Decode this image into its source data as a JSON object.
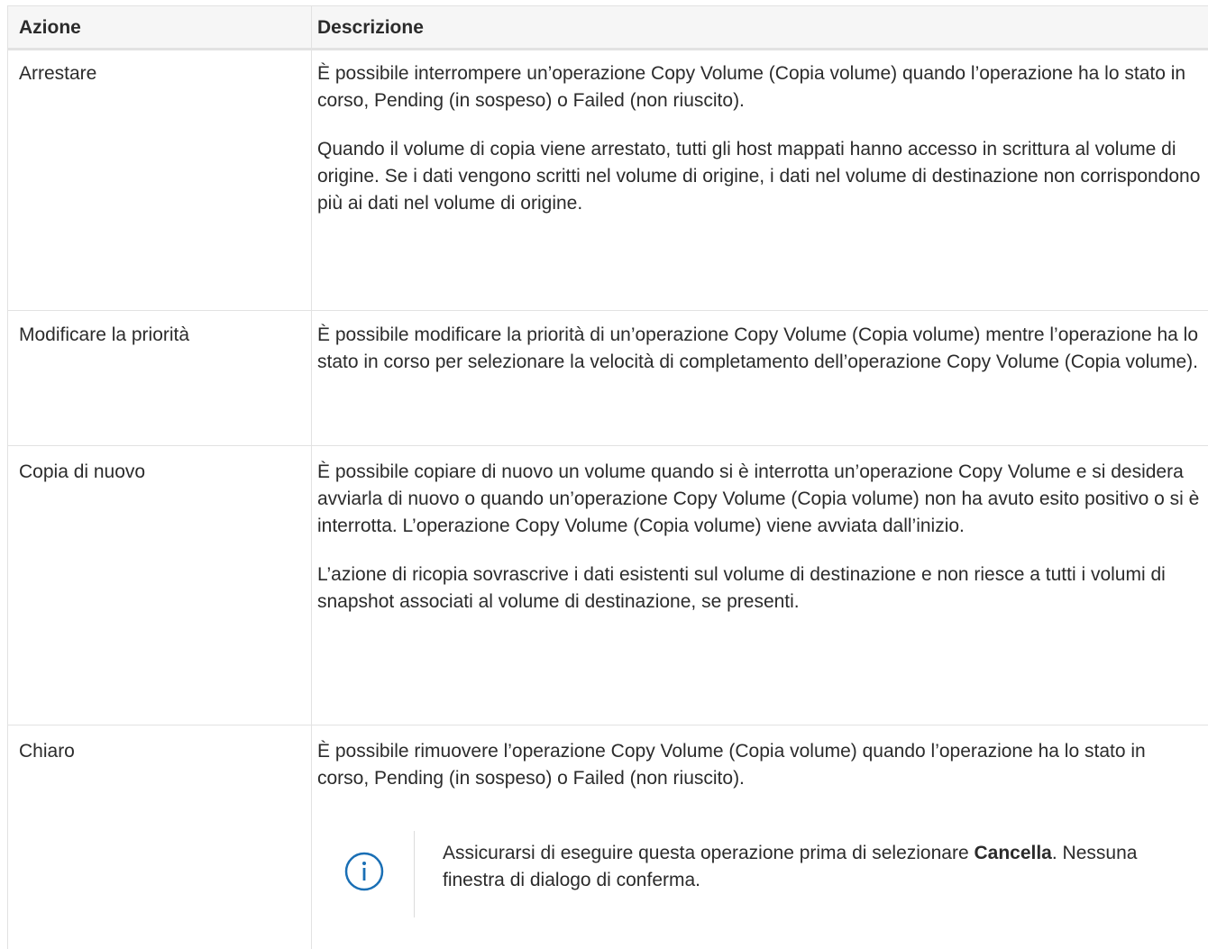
{
  "table": {
    "headers": {
      "action": "Azione",
      "description": "Descrizione"
    },
    "rows": [
      {
        "action": "Arrestare",
        "paragraphs": [
          "È possibile interrompere un’operazione Copy Volume (Copia volume) quando l’operazione ha lo stato in corso, Pending (in sospeso) o Failed (non riuscito).",
          "Quando il volume di copia viene arrestato, tutti gli host mappati hanno accesso in scrittura al volume di origine. Se i dati vengono scritti nel volume di origine, i dati nel volume di destinazione non corrispondono più ai dati nel volume di origine."
        ]
      },
      {
        "action": "Modificare la priorità",
        "paragraphs": [
          "È possibile modificare la priorità di un’operazione Copy Volume (Copia volume) mentre l’operazione ha lo stato in corso per selezionare la velocità di completamento dell’operazione Copy Volume (Copia volume)."
        ]
      },
      {
        "action": "Copia di nuovo",
        "paragraphs": [
          "È possibile copiare di nuovo un volume quando si è interrotta un’operazione Copy Volume e si desidera avviarla di nuovo o quando un’operazione Copy Volume (Copia volume) non ha avuto esito positivo o si è interrotta. L’operazione Copy Volume (Copia volume) viene avviata dall’inizio.",
          "L’azione di ricopia sovrascrive i dati esistenti sul volume di destinazione e non riesce a tutti i volumi di snapshot associati al volume di destinazione, se presenti."
        ]
      },
      {
        "action": "Chiaro",
        "paragraphs": [
          "È possibile rimuovere l’operazione Copy Volume (Copia volume) quando l’operazione ha lo stato in corso, Pending (in sospeso) o Failed (non riuscito)."
        ],
        "note": {
          "icon": "info-icon",
          "text_before": "Assicurarsi di eseguire questa operazione prima di selezionare ",
          "bold": "Cancella",
          "text_after": ". Nessuna finestra di dialogo di conferma."
        }
      }
    ]
  },
  "colors": {
    "text": "#2b2b2b",
    "border": "#e2e2e2",
    "header_bg": "#f6f6f6",
    "icon": "#1a6fb5"
  }
}
